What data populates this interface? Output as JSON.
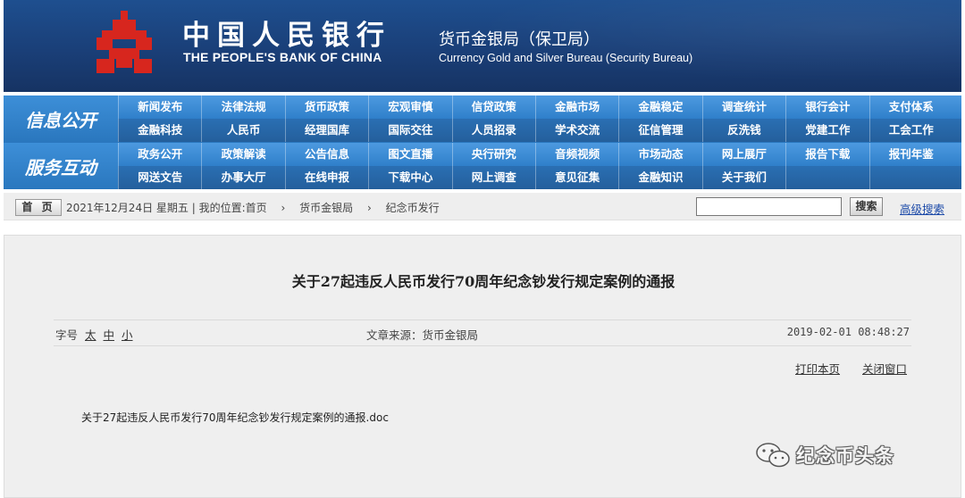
{
  "banner": {
    "cn_name": "中国人民银行",
    "en_name": "THE PEOPLE'S BANK OF CHINA",
    "bureau_cn": "货币金银局（保卫局）",
    "bureau_en": "Currency Gold and Silver Bureau (Security Bureau)"
  },
  "nav": {
    "section1": "信息公开",
    "section2": "服务互动",
    "rows": [
      [
        "新闻发布",
        "法律法规",
        "货币政策",
        "宏观审慎",
        "信贷政策",
        "金融市场",
        "金融稳定",
        "调查统计",
        "银行会计",
        "支付体系"
      ],
      [
        "金融科技",
        "人民币",
        "经理国库",
        "国际交往",
        "人员招录",
        "学术交流",
        "征信管理",
        "反洗钱",
        "党建工作",
        "工会工作"
      ],
      [
        "政务公开",
        "政策解读",
        "公告信息",
        "图文直播",
        "央行研究",
        "音频视频",
        "市场动态",
        "网上展厅",
        "报告下载",
        "报刊年鉴"
      ],
      [
        "网送文告",
        "办事大厅",
        "在线申报",
        "下载中心",
        "网上调查",
        "意见征集",
        "金融知识",
        "关于我们",
        "",
        ""
      ]
    ]
  },
  "crumbbar": {
    "home": "首 页",
    "date": "2021年12月24日 星期五",
    "location": "我的位置:首页",
    "crumb1": "货币金银局",
    "crumb2": "纪念币发行",
    "search_button": "搜索",
    "search_value": "",
    "advanced_search": "高级搜索"
  },
  "article": {
    "title": "关于27起违反人民币发行70周年纪念钞发行规定案例的通报",
    "font_size_label": "字号",
    "font_large": "太",
    "font_medium": "中",
    "font_small": "小",
    "source": "文章来源：货币金银局",
    "datetime": "2019-02-01 08:48:27",
    "print": "打印本页",
    "close": "关闭窗口",
    "attachment": "关于27起违反人民币发行70周年纪念钞发行规定案例的通报.doc"
  },
  "watermark": {
    "text": "纪念币头条",
    "icon": "wechat-icon"
  },
  "colors": {
    "banner_blue": "#1a3f78",
    "nav_blue": "#2a77be",
    "logo_red": "#d7261e",
    "link_blue": "#1b49a8"
  }
}
